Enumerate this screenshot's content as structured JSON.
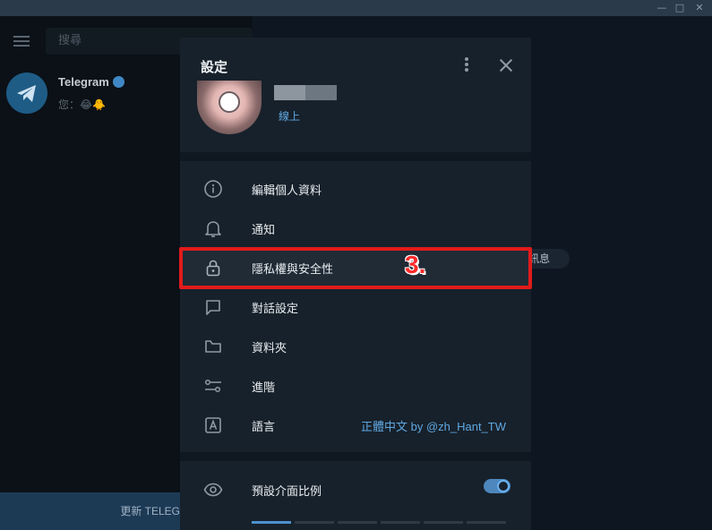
{
  "window": {
    "minimize_glyph": "—",
    "maximize_glyph": "□",
    "close_glyph": "✕"
  },
  "sidebar": {
    "search_placeholder": "搜尋",
    "chat": {
      "title": "Telegram",
      "preview": "您：😂🐥"
    },
    "update_label": "更新 TELEGRAM"
  },
  "background": {
    "pill_text": "訊息"
  },
  "settings": {
    "title": "設定",
    "profile": {
      "status": "線上"
    },
    "items": [
      {
        "label": "編輯個人資料",
        "icon": "info-icon"
      },
      {
        "label": "通知",
        "icon": "bell-icon"
      },
      {
        "label": "隱私權與安全性",
        "icon": "lock-icon"
      },
      {
        "label": "對話設定",
        "icon": "chat-icon"
      },
      {
        "label": "資料夾",
        "icon": "folder-icon"
      },
      {
        "label": "進階",
        "icon": "sliders-icon"
      },
      {
        "label": "語言",
        "icon": "language-icon",
        "value": "正體中文 by @zh_Hant_TW"
      }
    ],
    "scale": {
      "label": "預設介面比例",
      "enabled": true,
      "selected_step": 1,
      "step_count": 6
    }
  },
  "annotation": {
    "step": "3."
  },
  "colors": {
    "accent": "#5fa8e2",
    "highlight_border": "#e11b1b",
    "dialog_bg": "#17212b"
  }
}
